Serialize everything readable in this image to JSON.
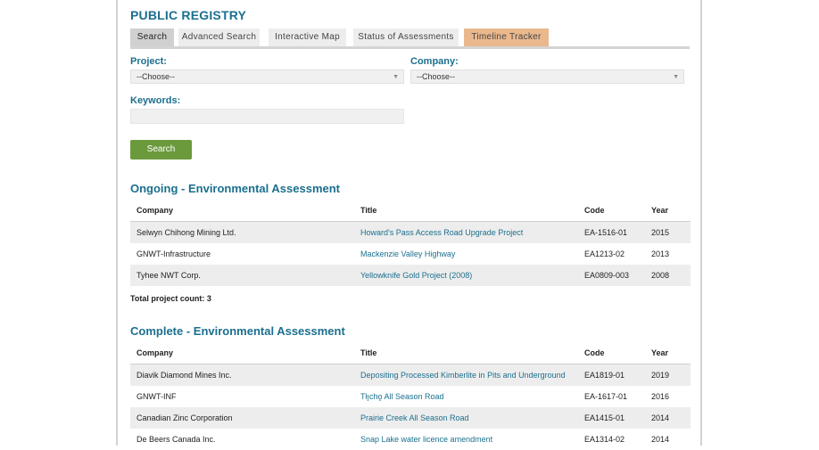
{
  "page_title": "PUBLIC REGISTRY",
  "tabs": [
    {
      "label": "Search"
    },
    {
      "label": "Advanced Search"
    },
    {
      "label": "Interactive Map"
    },
    {
      "label": "Status of Assessments"
    },
    {
      "label": "Timeline Tracker"
    }
  ],
  "form": {
    "project_label": "Project:",
    "project_value": "--Choose--",
    "company_label": "Company:",
    "company_value": "--Choose--",
    "keywords_label": "Keywords:",
    "keywords_value": "",
    "search_button": "Search"
  },
  "columns": {
    "company": "Company",
    "title": "Title",
    "code": "Code",
    "year": "Year"
  },
  "ongoing": {
    "heading": "Ongoing - Environmental Assessment",
    "rows": [
      {
        "company": "Selwyn Chihong Mining Ltd.",
        "title": "Howard's Pass Access Road Upgrade Project",
        "code": "EA-1516-01",
        "year": "2015"
      },
      {
        "company": "GNWT-Infrastructure",
        "title": "Mackenzie Valley Highway",
        "code": "EA1213-02",
        "year": "2013"
      },
      {
        "company": "Tyhee NWT Corp.",
        "title": "Yellowknife Gold Project (2008)",
        "code": "EA0809-003",
        "year": "2008"
      }
    ],
    "count_text": "Total project count: 3"
  },
  "complete": {
    "heading": "Complete - Environmental Assessment",
    "rows": [
      {
        "company": "Diavik Diamond Mines Inc.",
        "title": "Depositing Processed Kimberlite in Pits and Underground",
        "code": "EA1819-01",
        "year": "2019"
      },
      {
        "company": "GNWT-INF",
        "title": "Tłı̨chǫ All Season Road",
        "code": "EA-1617-01",
        "year": "2016"
      },
      {
        "company": "Canadian Zinc Corporation",
        "title": "Prairie Creek All Season Road",
        "code": "EA1415-01",
        "year": "2014"
      },
      {
        "company": "De Beers Canada Inc.",
        "title": "Snap Lake water licence amendment",
        "code": "EA1314-02",
        "year": "2014"
      }
    ]
  }
}
